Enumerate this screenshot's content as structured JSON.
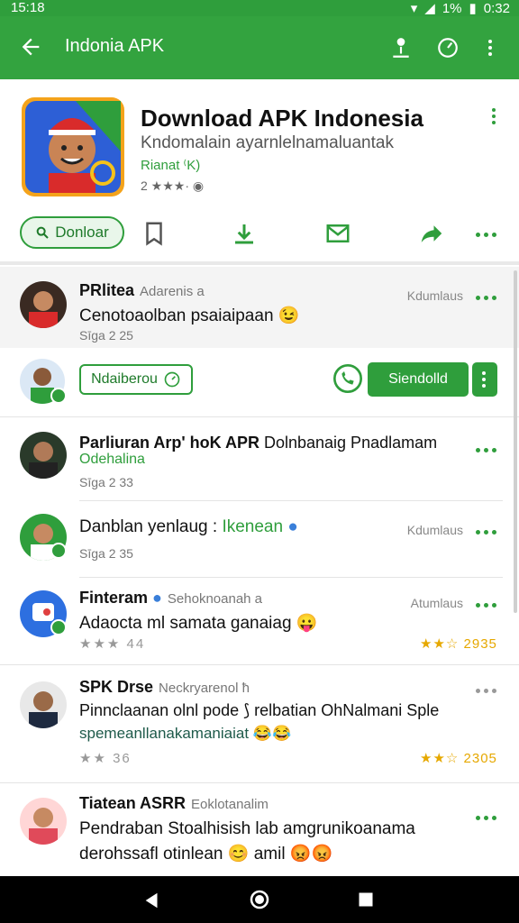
{
  "status": {
    "time": "15:18",
    "battery": "1%",
    "clock_right": "0:32"
  },
  "appbar": {
    "title": "Indonia APK",
    "icons": [
      "back-arrow-icon",
      "pin-icon",
      "speed-icon",
      "kebab-icon"
    ]
  },
  "app": {
    "title": "Download APK Indonesia",
    "subtitle": "Kndomalain ayarnlelnamaluantak",
    "tag": "Rianat ⁽K)",
    "rating_text": "2 ★★★·",
    "download_label": "Donloar"
  },
  "feed": [
    {
      "name": "PRlitea",
      "handle": "Adarenis a",
      "body": "Cenotoaolban psaiaipaan 😉",
      "meta": "Sīga  2 25",
      "right": "Kdumlaus"
    },
    {
      "promo_label": "Ndaiberou",
      "action_label": "Siendolld"
    },
    {
      "name": "Parliuran Arp' hoK APR",
      "name_tail": "Dolnbanaig Pnadlamam",
      "sub": "Odehalina",
      "meta": "Sīga  2 33"
    },
    {
      "name": "Danblan yenlaug :",
      "name_accent": "Ikenean",
      "meta": "Sīga  2 35",
      "right": "Kdumlaus"
    },
    {
      "name": "Finteram",
      "handle": "Sehoknoanah a",
      "body": "Adaocta ml samata ganaiag 😛",
      "meta": "44",
      "right": "Atumlaus",
      "right_meta": "2935"
    },
    {
      "name": "SPK Drse",
      "handle": "Neckryarenol ħ",
      "body": "Pinnclaanan olnl pode ⟆ relbatian OhNalmani Sple",
      "body2": "spemeanllanakamaniaiat 😂😂",
      "meta": "36",
      "right_meta": "2305"
    },
    {
      "name": "Tiatean ASRR",
      "handle": "Eoklotanalim",
      "body": "Pendraban Stoalhisish lab amgrunikoanama",
      "body2": "derohssafl otinlean 😊 amil 😡😡"
    }
  ],
  "colors": {
    "primary": "#33a33f",
    "accent": "#2f9e3c",
    "star": "#e6a800"
  }
}
